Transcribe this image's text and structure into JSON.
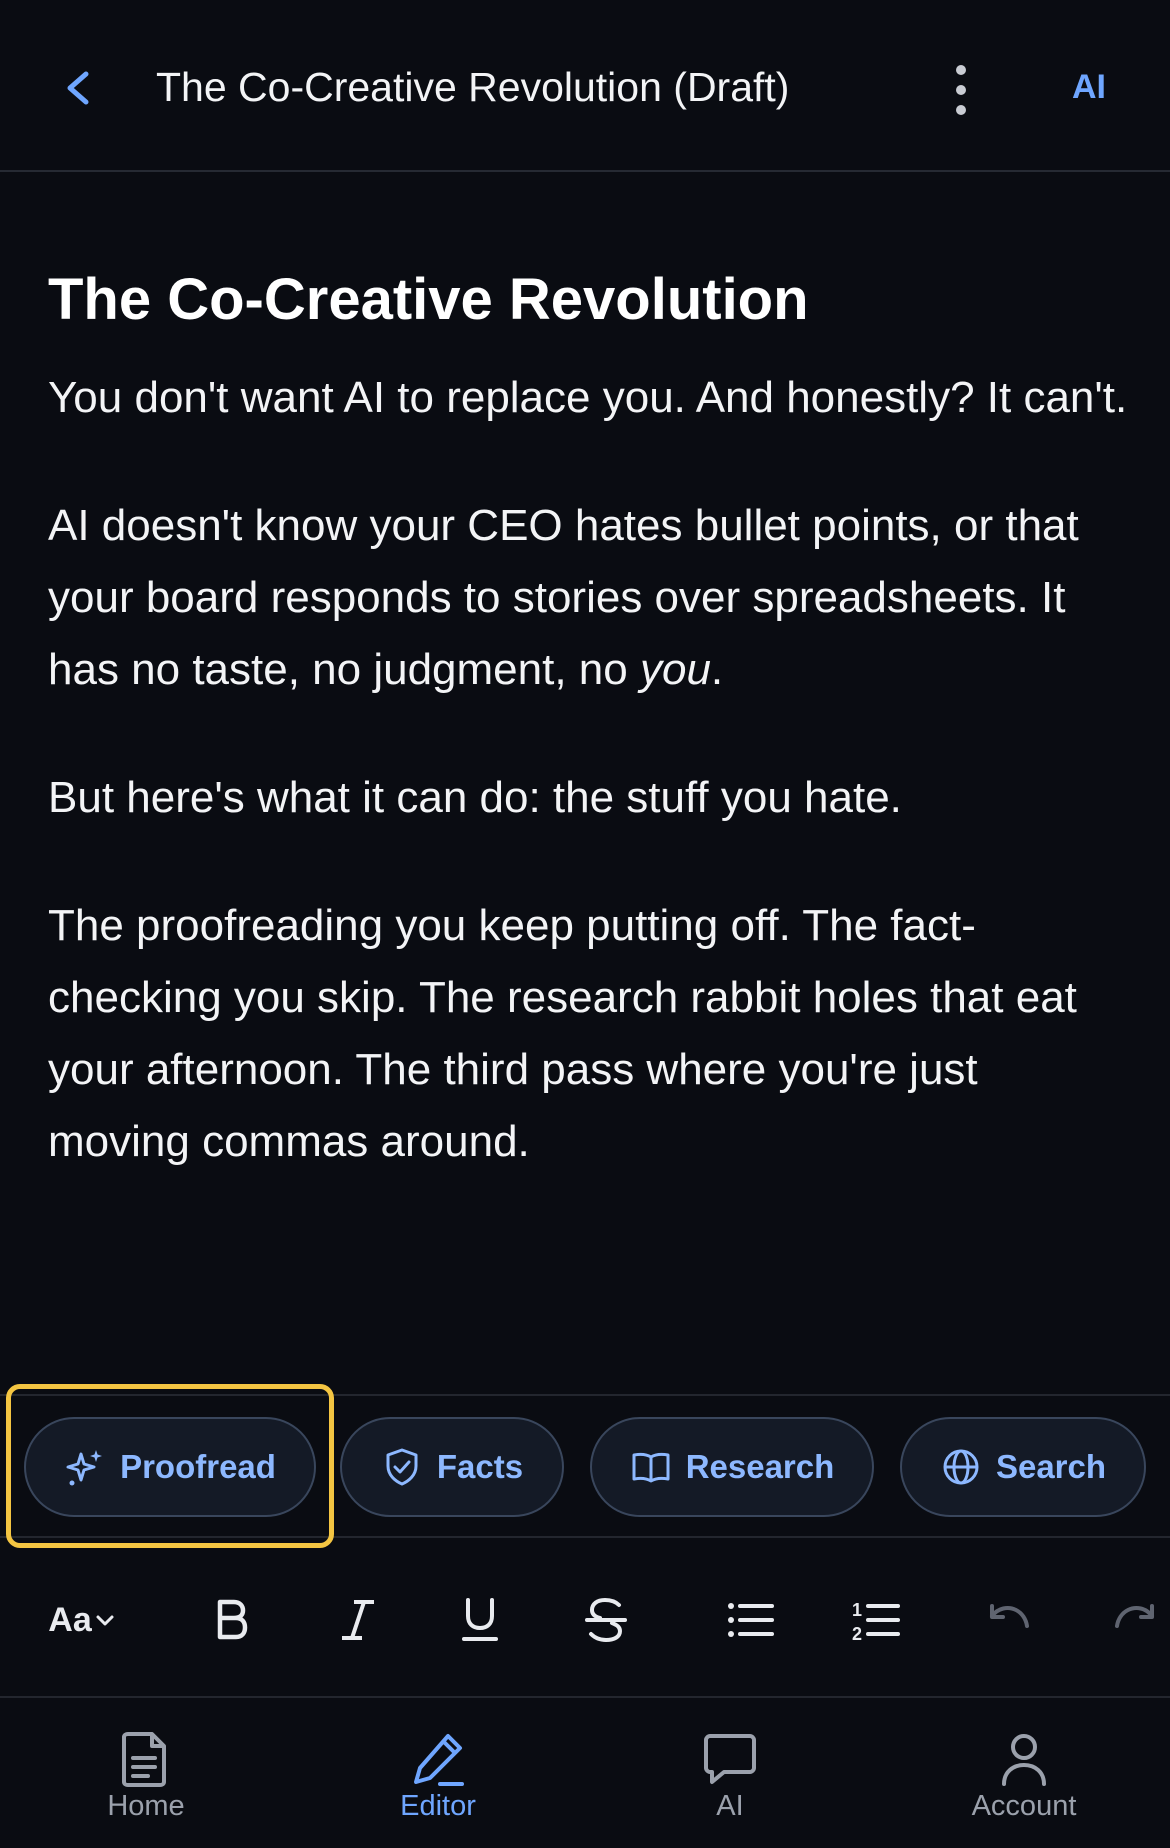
{
  "header": {
    "title": "The Co-Creative Revolution (Draft)",
    "ai_label": "AI",
    "back_icon": "chevron-left-icon",
    "more_icon": "more-vertical-icon"
  },
  "article": {
    "title": "The Co-Creative Revolution",
    "paragraphs": {
      "p1": "You don't want AI to replace you. And honestly? It can't.",
      "p2_main": "AI doesn't know your CEO hates bullet points, or that your board responds to stories over spreadsheets. It has no taste, no judgment, no ",
      "p2_emphasis": "you",
      "p2_end": ".",
      "p3": "But here's what it can do: the stuff you hate.",
      "p4": "The proofreading you keep putting off. The fact-checking you skip. The research rabbit holes that eat your afternoon. The third pass where you're just moving commas around."
    }
  },
  "ai_tools": {
    "proofread": "Proofread",
    "facts": "Facts",
    "research": "Research",
    "search": "Search"
  },
  "format_toolbar": {
    "font_label": "Aa"
  },
  "bottom_nav": {
    "home": "Home",
    "editor": "Editor",
    "ai": "AI",
    "account": "Account"
  },
  "colors": {
    "background": "#0a0c12",
    "accent": "#6fa6ff",
    "chip_text": "#8db8ff",
    "highlight": "#f4c542"
  }
}
